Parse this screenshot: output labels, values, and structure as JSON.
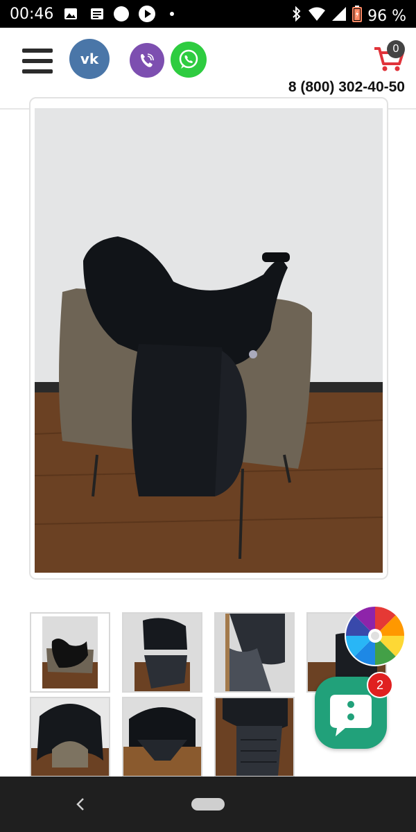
{
  "status_bar": {
    "time": "00:46",
    "battery": "96 %",
    "icons": [
      "gallery-icon",
      "news-icon",
      "circle-icon",
      "play-icon",
      "dot-icon",
      "bluetooth-icon",
      "wifi-icon",
      "signal-icon",
      "battery-icon"
    ]
  },
  "header": {
    "menu_icon": "hamburger-menu-icon",
    "social": [
      {
        "name": "vk",
        "icon": "vk-logo-icon",
        "color": "#4a76a8"
      },
      {
        "name": "viber",
        "icon": "viber-logo-icon",
        "color": "#7d4fb0"
      },
      {
        "name": "whatsapp",
        "icon": "whatsapp-logo-icon",
        "color": "#2ecc40"
      }
    ],
    "cart_count": "0",
    "cart_color": "#e0333a",
    "phone": "8 (800) 302-40-50"
  },
  "product": {
    "main_image": "saddle-photo",
    "thumbnails": [
      "saddle-side-view",
      "saddle-back-view",
      "saddle-flap-view",
      "saddle-angle-view",
      "saddle-gullet-view",
      "saddle-underside-view",
      "saddle-panel-view"
    ]
  },
  "widgets": {
    "fortune_wheel": "fortune-wheel-icon",
    "chat_badge": "2",
    "chat_color": "#21a17a"
  },
  "nav": {
    "back": "back-icon",
    "home": "home-pill"
  }
}
